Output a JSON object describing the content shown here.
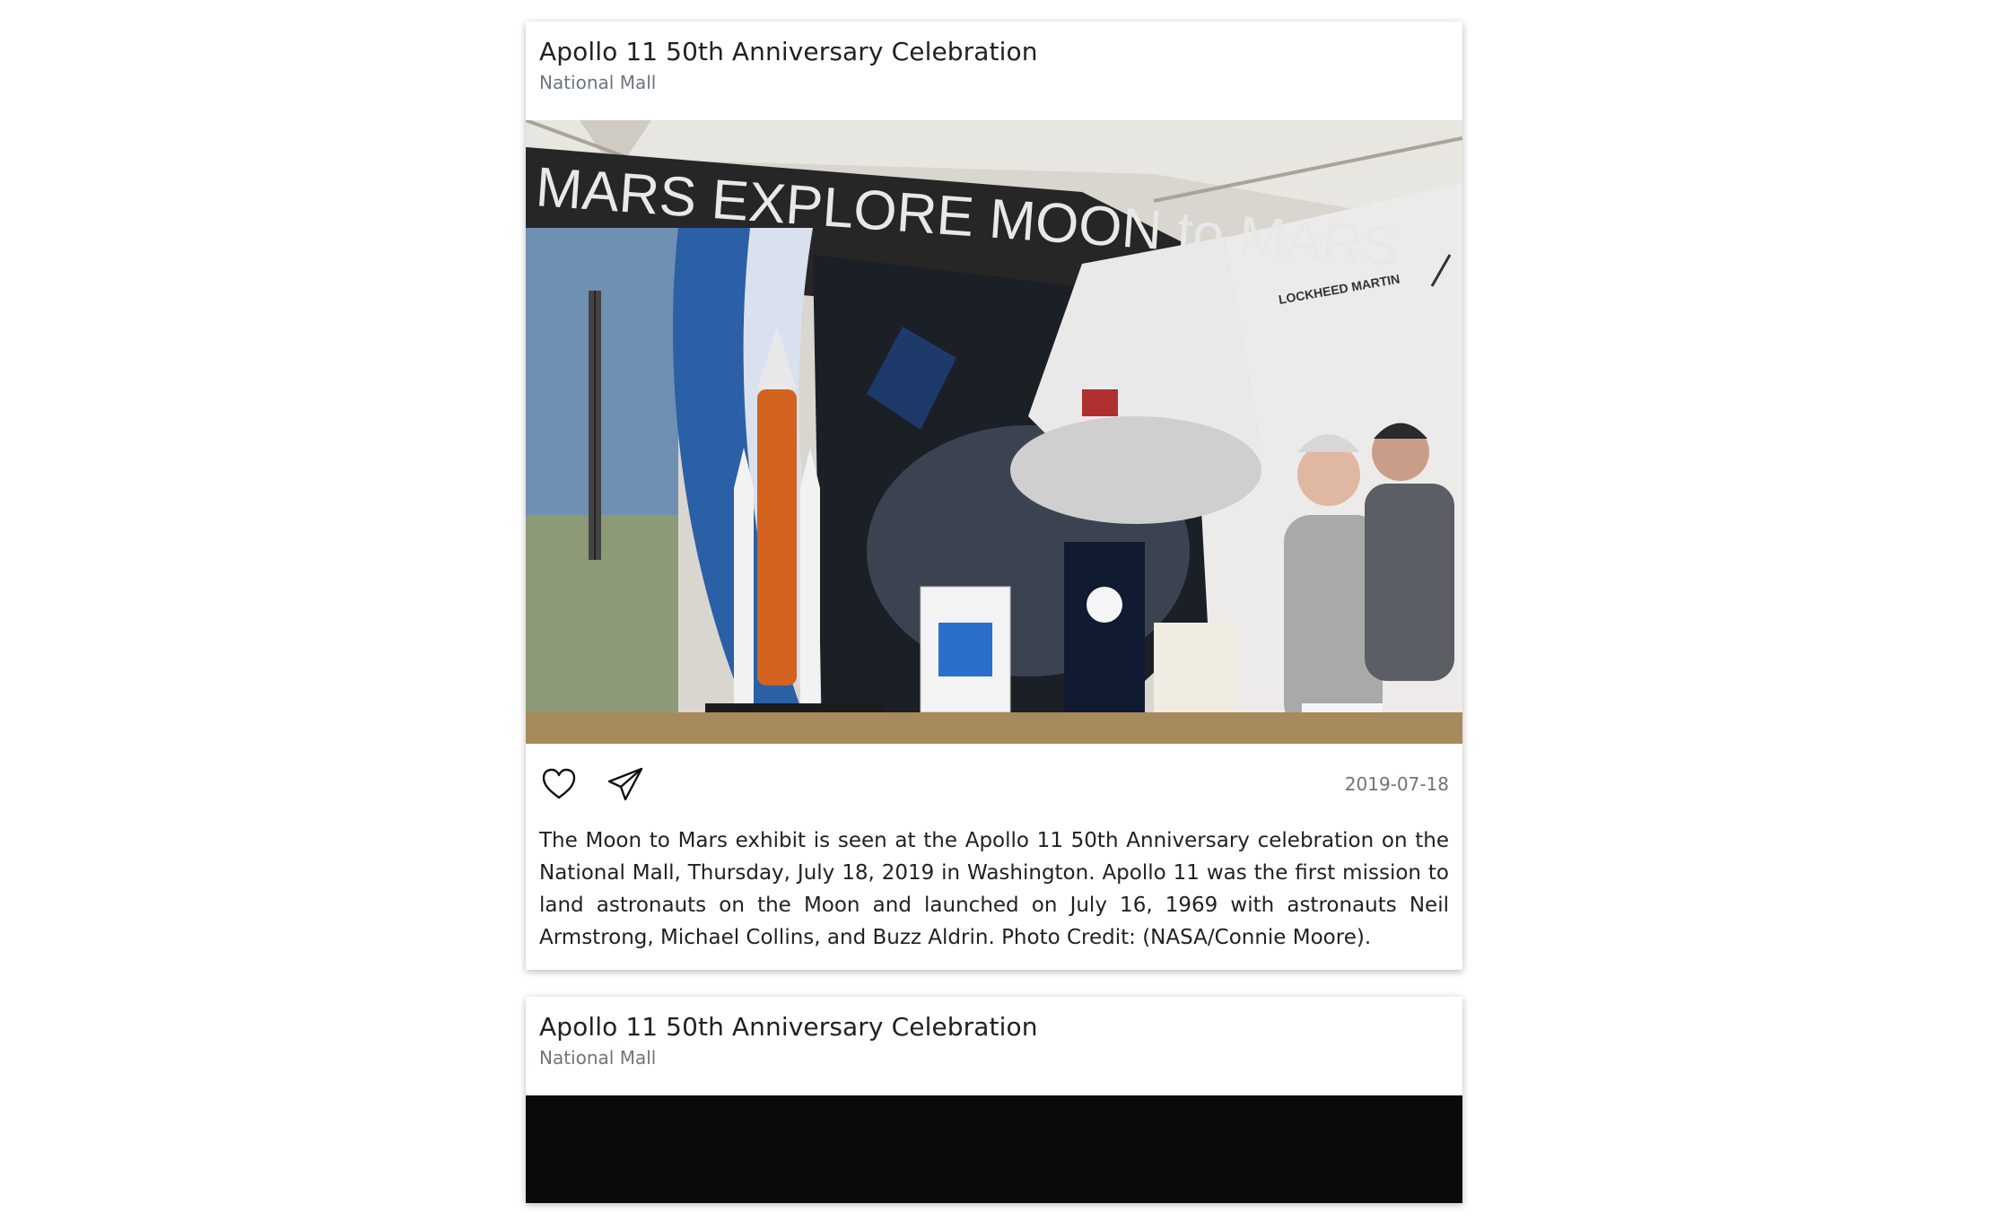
{
  "posts": [
    {
      "title": "Apollo 11 50th Anniversary Celebration",
      "location": "National Mall",
      "date": "2019-07-18",
      "caption": "The Moon to Mars exhibit is seen at the Apollo 11 50th Anniversary celebration on the National Mall, Thursday, July 18, 2019 in Washington. Apollo 11 was the first mission to land astronauts on the Moon and launched on July 16, 1969 with astronauts Neil Armstrong, Michael Collins, and Buzz Aldrin. Photo Credit: (NASA/Connie Moore).",
      "photo": {
        "banner_text": "MARS EXPLORE MOON to MARS",
        "sign_text": "LOCKHEED MARTIN"
      },
      "icons": [
        "heart-icon",
        "send-icon"
      ]
    },
    {
      "title": "Apollo 11 50th Anniversary Celebration",
      "location": "National Mall"
    }
  ]
}
